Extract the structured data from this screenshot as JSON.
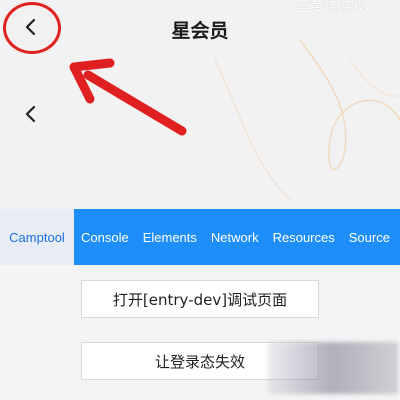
{
  "header": {
    "title": "星会员",
    "watermark": "蓝莓睛游戏"
  },
  "tabs": [
    {
      "label": "Camptool",
      "active": true
    },
    {
      "label": "Console",
      "active": false
    },
    {
      "label": "Elements",
      "active": false
    },
    {
      "label": "Network",
      "active": false
    },
    {
      "label": "Resources",
      "active": false
    },
    {
      "label": "Source",
      "active": false
    }
  ],
  "buttons": {
    "open_debug": "打开[entry-dev]调试页面",
    "invalidate_login": "让登录态失效"
  },
  "colors": {
    "tabbar": "#1e8ffa",
    "annotation_red": "#e02020"
  },
  "icons": {
    "back": "chevron-left-icon"
  }
}
